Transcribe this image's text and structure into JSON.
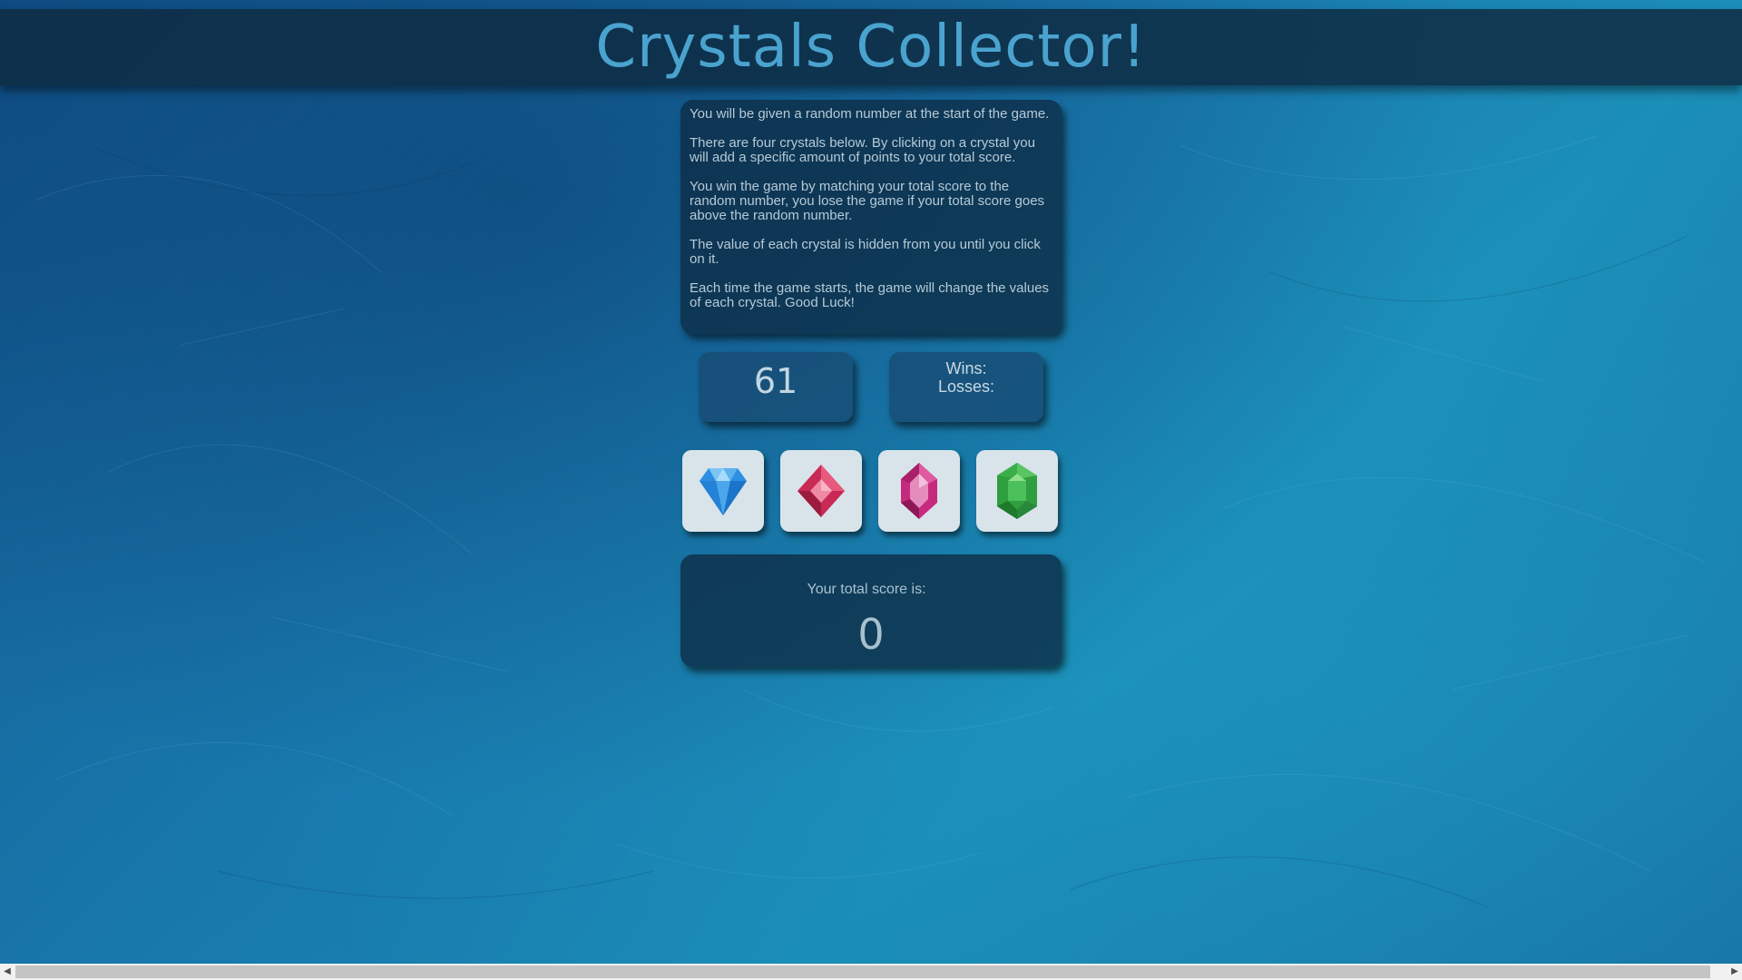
{
  "title": "Crystals Collector!",
  "instructions": [
    "You will be given a random number at the start of the game.",
    "There are four crystals below. By clicking on a crystal you will add a specific amount of points to your total score.",
    "You win the game by matching your total score to the random number, you lose the game if your total score goes above the random number.",
    "The value of each crystal is hidden from you until you click on it.",
    "Each time the game starts, the game will change the values of each crystal. Good Luck!"
  ],
  "target_number": "61",
  "record": {
    "wins_label": "Wins:",
    "losses_label": "Losses:"
  },
  "crystals": [
    {
      "icon": "blue-diamond-icon",
      "color": "#2a8fe0"
    },
    {
      "icon": "red-crystal-icon",
      "color": "#d8365f"
    },
    {
      "icon": "pink-crystal-icon",
      "color": "#d0348a"
    },
    {
      "icon": "green-emerald-icon",
      "color": "#3cb34a"
    }
  ],
  "score": {
    "label": "Your total score is:",
    "value": "0"
  },
  "scrollbar": {
    "left_arrow": "◀",
    "right_arrow": "▶"
  }
}
